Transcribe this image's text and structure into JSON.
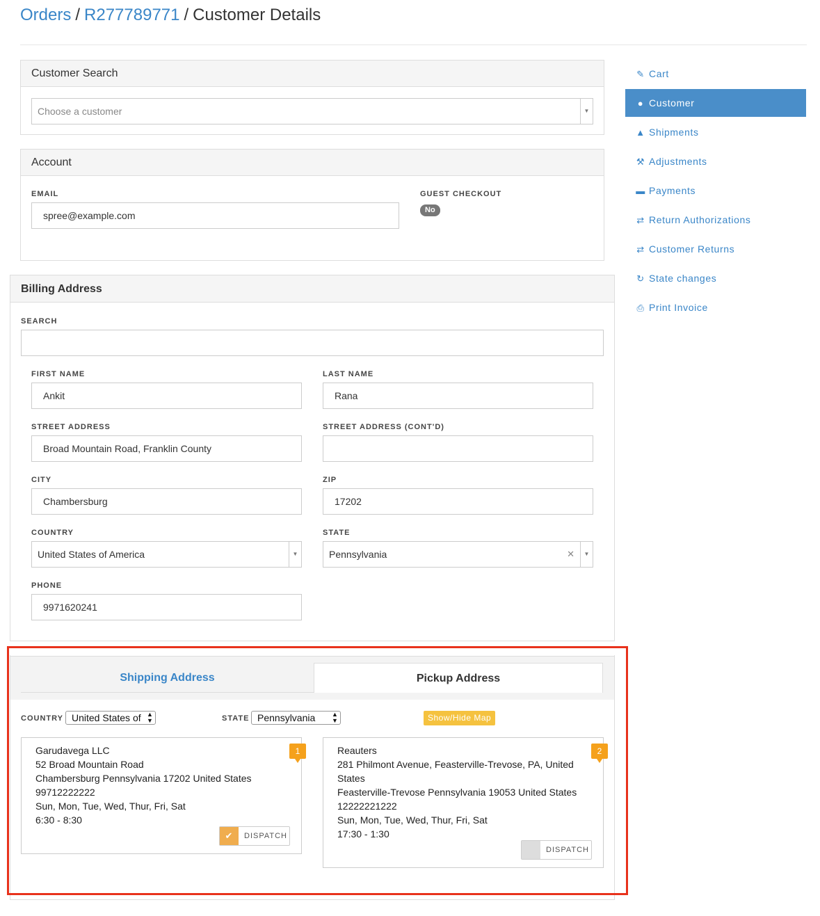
{
  "breadcrumb": {
    "orders": "Orders",
    "order_number": "R277789771",
    "current": "Customer Details",
    "separator": "/"
  },
  "customer_search": {
    "title": "Customer Search",
    "placeholder": "Choose a customer"
  },
  "account": {
    "title": "Account",
    "email_label": "EMAIL",
    "email_value": "spree@example.com",
    "guest_label": "GUEST CHECKOUT",
    "guest_value": "No"
  },
  "billing": {
    "title": "Billing Address",
    "search_label": "SEARCH",
    "search_value": "",
    "first_name_label": "FIRST NAME",
    "first_name": "Ankit",
    "last_name_label": "LAST NAME",
    "last_name": "Rana",
    "street_label": "STREET ADDRESS",
    "street": "Broad Mountain Road, Franklin County",
    "street2_label": "STREET ADDRESS (CONT'D)",
    "street2": "",
    "city_label": "CITY",
    "city": "Chambersburg",
    "zip_label": "ZIP",
    "zip": "17202",
    "country_label": "COUNTRY",
    "country": "United States of America",
    "state_label": "STATE",
    "state": "Pennsylvania",
    "phone_label": "PHONE",
    "phone": "9971620241"
  },
  "sidebar": {
    "items": [
      {
        "label": "Cart",
        "icon": "pencil-icon"
      },
      {
        "label": "Customer",
        "icon": "user-icon",
        "active": true
      },
      {
        "label": "Shipments",
        "icon": "road-icon"
      },
      {
        "label": "Adjustments",
        "icon": "wrench-icon"
      },
      {
        "label": "Payments",
        "icon": "credit-card-icon"
      },
      {
        "label": "Return Authorizations",
        "icon": "transfer-icon"
      },
      {
        "label": "Customer Returns",
        "icon": "transfer-icon"
      },
      {
        "label": "State changes",
        "icon": "refresh-icon"
      },
      {
        "label": "Print Invoice",
        "icon": "print-icon"
      }
    ],
    "active_color": "#4a8ec9",
    "link_color": "#3a86c8"
  },
  "delivery": {
    "tabs": {
      "shipping": "Shipping Address",
      "pickup": "Pickup Address"
    },
    "country_label": "COUNTRY",
    "country_value": "United States of",
    "state_label": "STATE",
    "state_value": "Pennsylvania",
    "map_button": "Show/Hide Map",
    "cards": [
      {
        "pin": "1",
        "lines": [
          "Garudavega LLC",
          "52 Broad Mountain Road",
          "Chambersburg Pennsylvania 17202 United States",
          "99712222222",
          "Sun, Mon, Tue, Wed, Thur, Fri, Sat",
          "6:30 - 8:30"
        ],
        "dispatch_label": "DISPATCH",
        "dispatch_checked": true
      },
      {
        "pin": "2",
        "lines": [
          "Reauters",
          "281 Philmont Avenue, Feasterville-Trevose, PA, United",
          "States",
          "Feasterville-Trevose Pennsylvania 19053 United States",
          "12222221222",
          "Sun, Mon, Tue, Wed, Thur, Fri, Sat",
          "17:30 - 1:30"
        ],
        "dispatch_label": "DISPATCH",
        "dispatch_checked": false
      }
    ],
    "highlight_color": "#e8321c",
    "pin_color": "#f5a11c"
  }
}
